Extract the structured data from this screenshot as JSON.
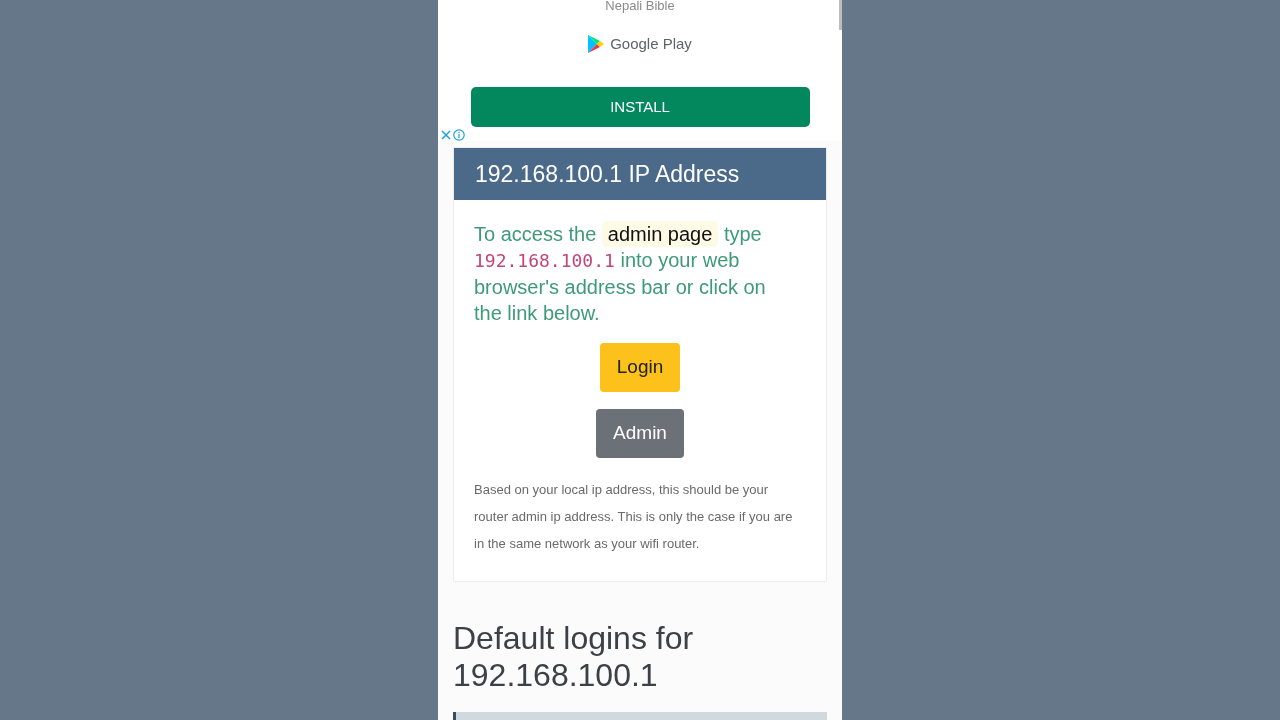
{
  "ad": {
    "app_name": "Nepali Bible",
    "store": "Google Play",
    "install_button": "INSTALL"
  },
  "card": {
    "title": "192.168.100.1 IP Address",
    "intro": [
      {
        "kind": "text",
        "text": "To access the "
      },
      {
        "kind": "highlight",
        "text": "admin page"
      },
      {
        "kind": "text",
        "text": " type "
      },
      {
        "kind": "code",
        "text": "192.168.100.1"
      },
      {
        "kind": "text",
        "text": " into your web browser's address bar or click on the link below."
      }
    ],
    "buttons": [
      {
        "label": "Login",
        "kind": "warning"
      },
      {
        "label": "Admin",
        "kind": "secondary"
      }
    ],
    "note": "Based on your local ip address, this should be your router admin ip address. This is only the case if you are in the same network as your wifi router."
  },
  "section": {
    "heading": "Default logins for 192.168.100.1"
  }
}
